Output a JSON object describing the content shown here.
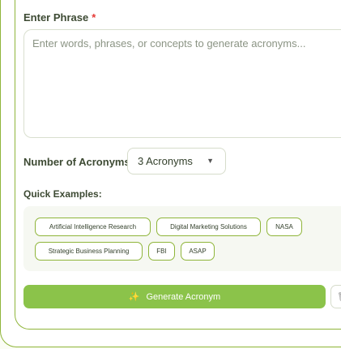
{
  "phrase": {
    "label": "Enter Phrase",
    "required_mark": "*",
    "placeholder": "Enter words, phrases, or concepts to generate acronyms...",
    "value": ""
  },
  "count": {
    "label": "Number of Acronyms:",
    "selected": "3 Acronyms",
    "caret_icon": "▼"
  },
  "quick_examples": {
    "label": "Quick Examples:",
    "chips": [
      "Artificial Intelligence Research",
      "Digital Marketing Solutions",
      "NASA",
      "Strategic Business Planning",
      "FBI",
      "ASAP"
    ]
  },
  "generate": {
    "icon": "magic-wand-icon",
    "icon_glyph": "✨",
    "label": "Generate Acronym"
  },
  "colors": {
    "accent": "#8bc34a",
    "border": "#8fb53a"
  }
}
